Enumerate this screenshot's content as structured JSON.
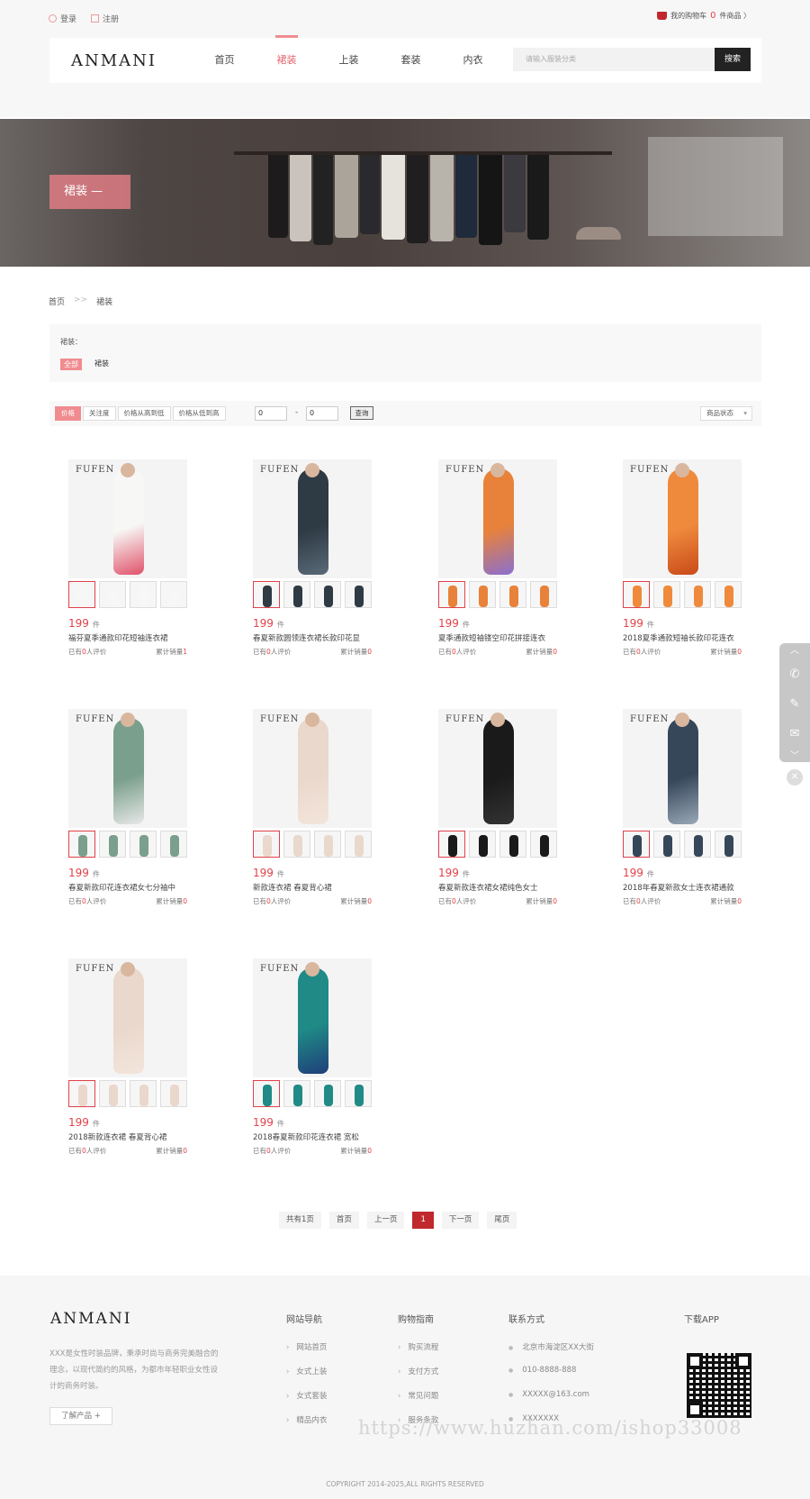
{
  "topbar": {
    "login": "登录",
    "register": "注册",
    "cart_prefix": "我的购物车",
    "cart_count": "0",
    "cart_suffix": "件商品 〉"
  },
  "header": {
    "logo": "ANMANI",
    "nav": [
      {
        "label": "首页"
      },
      {
        "label": "裙装",
        "active": true
      },
      {
        "label": "上装"
      },
      {
        "label": "套装"
      },
      {
        "label": "内衣"
      }
    ],
    "search_placeholder": "请输入服装分类",
    "search_button": "搜索"
  },
  "banner": {
    "title": "裙装 —"
  },
  "breadcrumb": {
    "home": "首页",
    "sep": ">>",
    "current": "裙装"
  },
  "filter": {
    "label": "裙装：",
    "options": [
      "全部",
      "裙装"
    ]
  },
  "sort": {
    "buttons": [
      "价格",
      "关注度",
      "价格从高到低",
      "价格从低到高"
    ],
    "price_from": "0",
    "price_dash": "-",
    "price_to": "0",
    "query_button": "查询",
    "status_select": "商品状态"
  },
  "products": [
    {
      "price": "199",
      "unit": "件",
      "name": "福芬夏季通款印花短袖连衣裙",
      "reviews": "0",
      "sales": "1",
      "color": "#f7f7f5",
      "accent": "#e0526a"
    },
    {
      "price": "199",
      "unit": "件",
      "name": "春夏新款圆领连衣裙长款印花显",
      "reviews": "0",
      "sales": "0",
      "color": "#2e3a44",
      "accent": "#5a6a78"
    },
    {
      "price": "199",
      "unit": "件",
      "name": "夏季通款短袖镂空印花拼接连衣",
      "reviews": "0",
      "sales": "0",
      "color": "#e8823a",
      "accent": "#8a6fd0"
    },
    {
      "price": "199",
      "unit": "件",
      "name": "2018夏季通款短袖长款印花连衣",
      "reviews": "0",
      "sales": "0",
      "color": "#ef8a3c",
      "accent": "#c94a1a"
    },
    {
      "price": "199",
      "unit": "件",
      "name": "春夏新款印花连衣裙女七分袖中",
      "reviews": "0",
      "sales": "0",
      "color": "#7a9f8c",
      "accent": "#e8e8e8"
    },
    {
      "price": "199",
      "unit": "件",
      "name": "新款连衣裙 春夏背心裙",
      "reviews": "0",
      "sales": "0",
      "color": "#ead8cc",
      "accent": "#f3e5dc"
    },
    {
      "price": "199",
      "unit": "件",
      "name": "春夏新款连衣裙女裙纯色女士",
      "reviews": "0",
      "sales": "0",
      "color": "#1a1a1a",
      "accent": "#333333"
    },
    {
      "price": "199",
      "unit": "件",
      "name": "2018年春夏新款女士连衣裙通款",
      "reviews": "0",
      "sales": "0",
      "color": "#36475a",
      "accent": "#9aa8b8"
    },
    {
      "price": "199",
      "unit": "件",
      "name": "2018新款连衣裙 春夏背心裙",
      "reviews": "0",
      "sales": "0",
      "color": "#ead8cc",
      "accent": "#f3e5dc"
    },
    {
      "price": "199",
      "unit": "件",
      "name": "2018春夏新款印花连衣裙 宽松",
      "reviews": "0",
      "sales": "0",
      "color": "#1f8a86",
      "accent": "#1f3f7a"
    }
  ],
  "product_labels": {
    "reviews_prefix": "已有",
    "reviews_suffix": "人评价",
    "sales_prefix": "累计销量",
    "brand": "FUFEN"
  },
  "pagination": {
    "total": "共有1页",
    "first": "首页",
    "prev": "上一页",
    "current": "1",
    "next": "下一页",
    "last": "尾页"
  },
  "sidetool": {
    "icons": [
      "chevron-up-icon",
      "phone-icon",
      "edit-icon",
      "mail-icon",
      "chevron-down-icon"
    ]
  },
  "footer": {
    "logo": "ANMANI",
    "desc": "XXX是女性时装品牌，秉承时尚与商务完美融合的理念，以现代简约的风格，为都市年轻职业女性设计的商务时装。",
    "more_button": "了解产品 +",
    "col1": {
      "title": "网站导航",
      "items": [
        "网站首页",
        "女式上装",
        "女式套装",
        "精品内衣"
      ]
    },
    "col2": {
      "title": "购物指南",
      "items": [
        "购买流程",
        "支付方式",
        "常见问题",
        "服务条款"
      ]
    },
    "col3": {
      "title": "联系方式",
      "items": [
        "北京市海淀区XX大街",
        "010-8888-888",
        "XXXXX@163.com",
        "XXXXXXX"
      ]
    },
    "col4": {
      "title": "下载APP"
    },
    "watermark": "https://www.huzhan.com/ishop33008",
    "copyright": "COPYRIGHT  2014-2025,ALL RIGHTS RESERVED"
  }
}
